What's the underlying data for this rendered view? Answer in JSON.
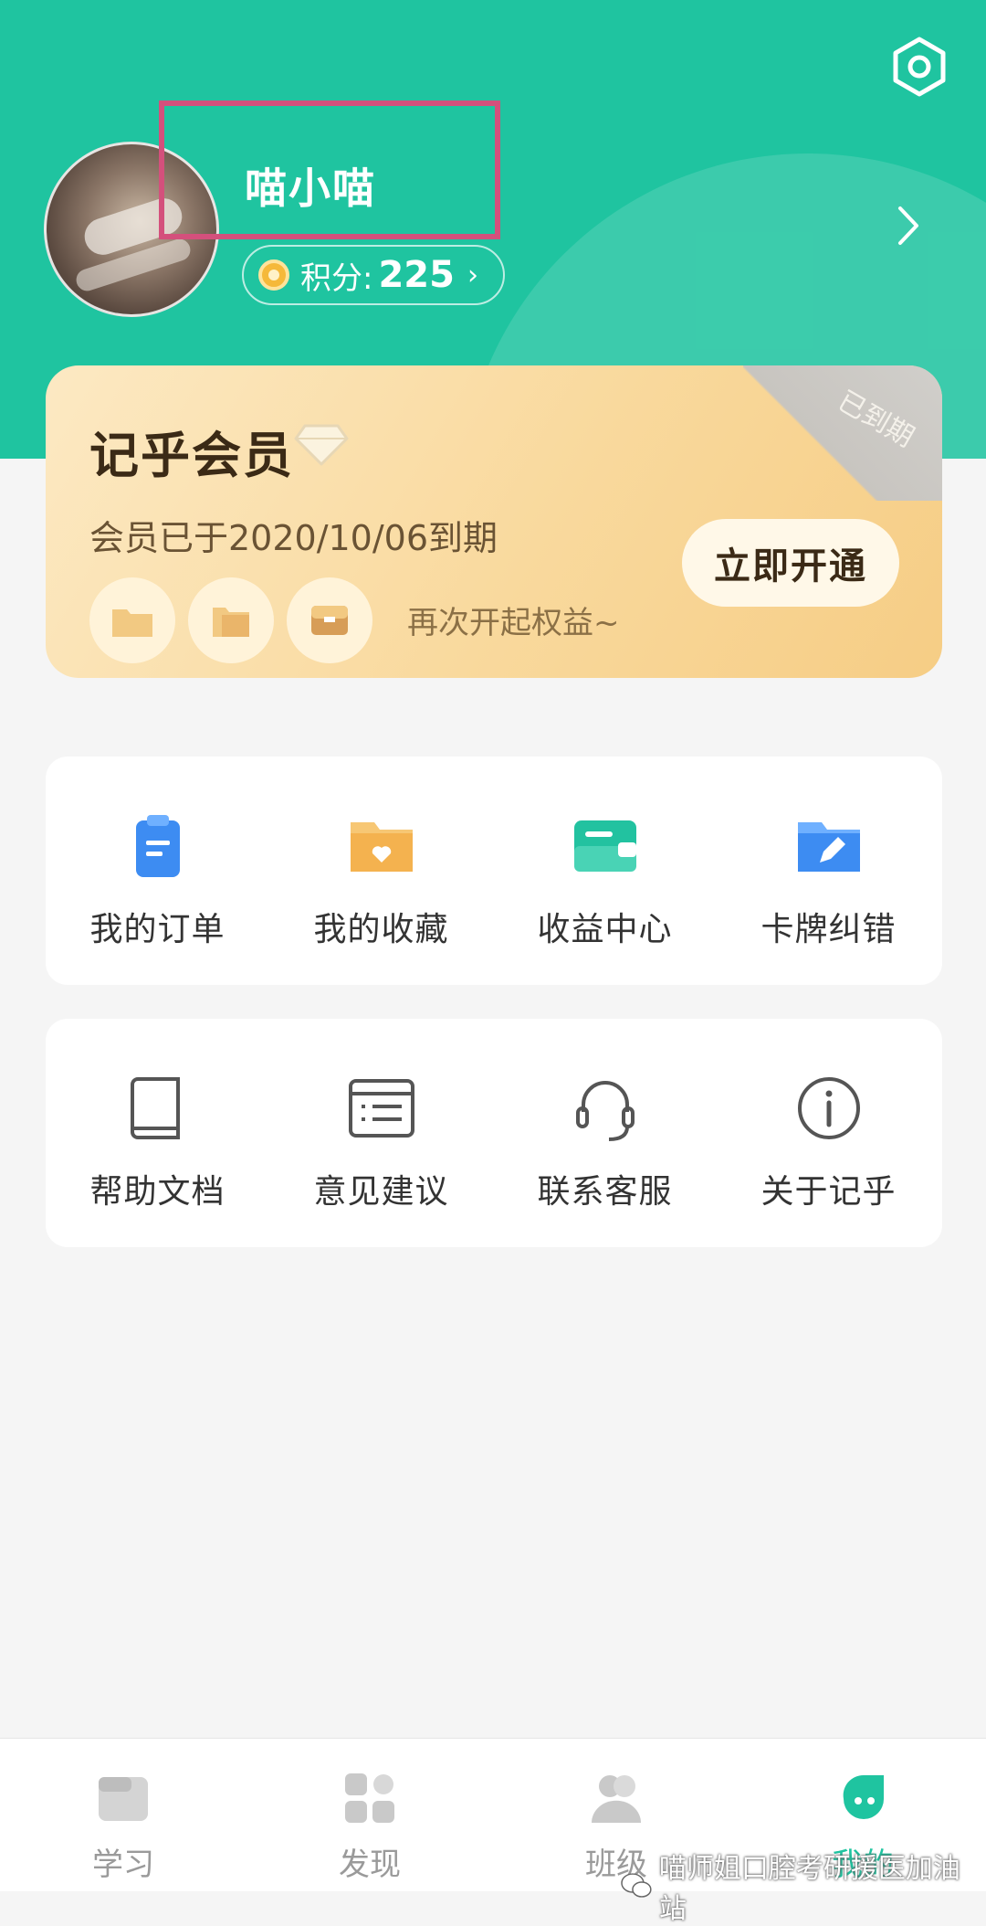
{
  "header": {
    "username": "喵小喵",
    "points_label": "积分:",
    "points_value": "225",
    "points_chevron": "›",
    "settings_icon": "settings-hexagon-icon",
    "background": "#1fc4a0"
  },
  "member": {
    "title": "记乎会员",
    "status_tag": "已到期",
    "expire_text": "会员已于2020/10/06到期",
    "open_button": "立即开通",
    "renew_text": "再次开起权益~"
  },
  "quick_menu": [
    {
      "label": "我的订单",
      "icon": "order-clipboard-icon",
      "color": "#3d8cf2"
    },
    {
      "label": "我的收藏",
      "icon": "favorite-folder-icon",
      "color": "#f4b24f"
    },
    {
      "label": "收益中心",
      "icon": "wallet-icon",
      "color": "#22c2a0"
    },
    {
      "label": "卡牌纠错",
      "icon": "edit-folder-icon",
      "color": "#3d8cf2"
    }
  ],
  "service_menu": [
    {
      "label": "帮助文档",
      "icon": "book-icon"
    },
    {
      "label": "意见建议",
      "icon": "feedback-list-icon"
    },
    {
      "label": "联系客服",
      "icon": "headset-icon"
    },
    {
      "label": "关于记乎",
      "icon": "info-icon"
    }
  ],
  "bottom_nav": [
    {
      "label": "学习",
      "icon": "study-icon"
    },
    {
      "label": "发现",
      "icon": "discover-icon"
    },
    {
      "label": "班级",
      "icon": "class-icon"
    },
    {
      "label": "我的",
      "icon": "mine-icon",
      "active": true
    }
  ],
  "watermark": "喵师姐口腔考研援医加油站"
}
